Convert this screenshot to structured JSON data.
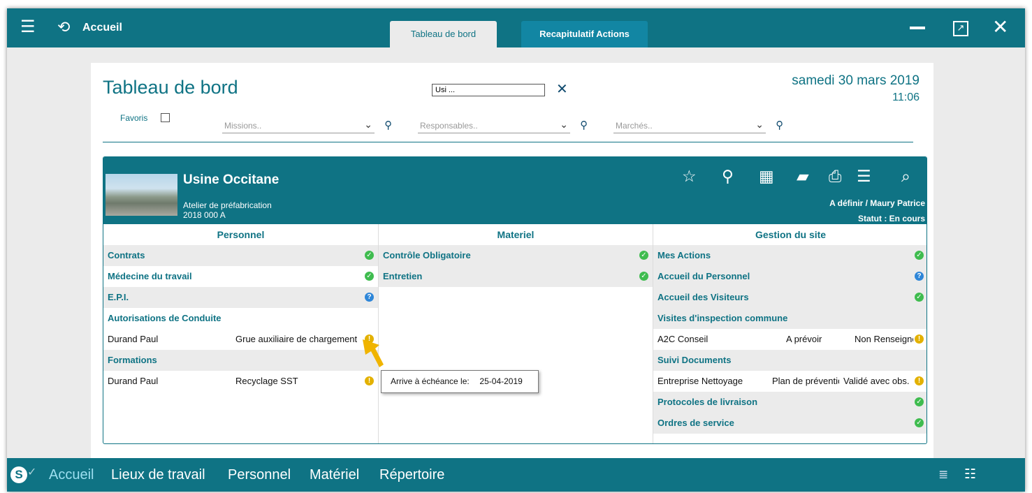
{
  "topbar": {
    "title": "Accueil",
    "tabs": [
      {
        "label": "Tableau de bord",
        "active": true
      },
      {
        "label": "Recapitulatif Actions",
        "active": false
      }
    ]
  },
  "dashboard": {
    "title": "Tableau de bord",
    "search_value": "Usi ...",
    "date": "samedi 30 mars 2019",
    "time": "11:06",
    "favoris_label": "Favoris",
    "filters": {
      "missions_placeholder": "Missions..",
      "responsables_placeholder": "Responsables..",
      "marches_placeholder": "Marchés.."
    }
  },
  "site": {
    "name": "Usine Occitane",
    "subtitle": "Atelier de préfabrication",
    "code": "2018 000 A",
    "responsables": "A définir  /  Maury Patrice",
    "status": "Statut : En cours"
  },
  "columns": {
    "personnel": {
      "header": "Personnel",
      "contrats": "Contrats",
      "medecine": "Médecine du travail",
      "epi": "E.P.I.",
      "autorisations": "Autorisations de Conduite",
      "auto_person": "Durand Paul",
      "auto_value": "Grue auxiliaire de chargement",
      "formations": "Formations",
      "form_person": "Durand Paul",
      "form_value": "Recyclage SST"
    },
    "materiel": {
      "header": "Materiel",
      "controle": "Contrôle Obligatoire",
      "entretien": "Entretien"
    },
    "gestion": {
      "header": "Gestion du site",
      "mes_actions": "Mes Actions",
      "accueil_personnel": "Accueil du Personnel",
      "accueil_visiteurs": "Accueil des Visiteurs",
      "visites": "Visites d'inspection commune",
      "visite_org": "A2C Conseil",
      "visite_state": "A prévoir",
      "visite_info": "Non Renseigné",
      "suivi_docs": "Suivi Documents",
      "suivi_org": "Entreprise Nettoyage",
      "suivi_doc": "Plan de prévention",
      "suivi_state": "Validé avec obs.",
      "protocoles": "Protocoles de livraison",
      "ordres": "Ordres de service"
    }
  },
  "tooltip": {
    "label": "Arrive à échéance le:",
    "date": "25-04-2019"
  },
  "bottombar": {
    "nav": [
      {
        "label": "Accueil",
        "active": true
      },
      {
        "label": "Lieux de travail"
      },
      {
        "label": "Personnel"
      },
      {
        "label": "Matériel"
      },
      {
        "label": "Répertoire"
      }
    ]
  },
  "colors": {
    "primary": "#0f7384",
    "ok": "#3fbc4f",
    "help": "#2e86d8",
    "warning": "#e3b100"
  },
  "icons": {
    "status_ok": "check-circle-icon",
    "status_help": "question-circle-icon",
    "status_warning": "exclamation-circle-icon"
  }
}
